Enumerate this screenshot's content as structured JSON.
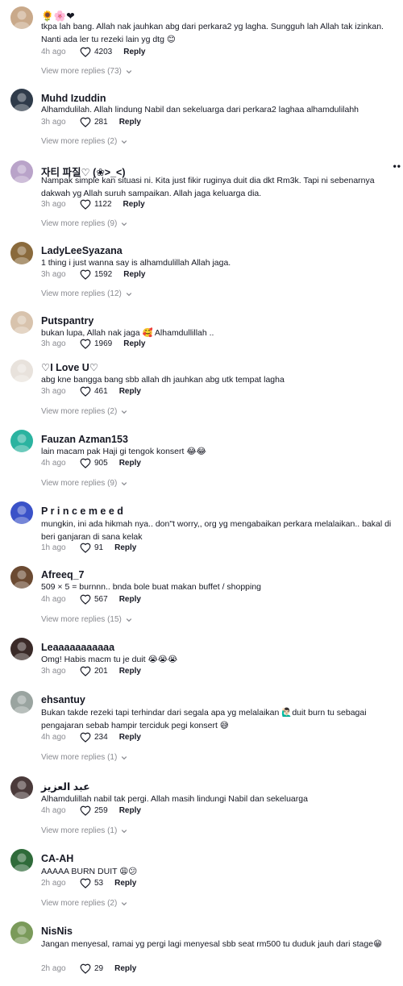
{
  "comments": [
    {
      "user": "🌻🌸❤",
      "text": "tkpa lah bang. Allah nak jauhkan abg dari perkara2 yg lagha. Sungguh lah Allah tak izinkan. Nanti ada ler tu rezeki lain yg dtg 😊",
      "time": "4h ago",
      "likes": "4203",
      "reply": "Reply",
      "more": "View more replies (73)",
      "avatar_color": "#c9a98a"
    },
    {
      "user": "Muhd Izuddin",
      "text": "Alhamdulilah. Allah lindung Nabil dan sekeluarga dari perkara2 laghaa alhamdulilahh",
      "time": "3h ago",
      "likes": "281",
      "reply": "Reply",
      "more": "View more replies (2)",
      "avatar_color": "#2f3b4a"
    },
    {
      "user": "자티 파질♡ (❀>_<)",
      "text": "Nampak simple kan situasi ni. Kita just fikir ruginya duit dia dkt Rm3k. Tapi ni sebenarnya dakwah yg Allah suruh sampaikan. Allah jaga keluarga dia.",
      "time": "3h ago",
      "likes": "1122",
      "reply": "Reply",
      "more": "View more replies (9)",
      "avatar_color": "#b9a3c9"
    },
    {
      "user": "LadyLeeSyazana",
      "text": "1 thing i just wanna say is alhamdulillah Allah jaga.",
      "time": "3h ago",
      "likes": "1592",
      "reply": "Reply",
      "more": "View more replies (12)",
      "avatar_color": "#8a6a3c"
    },
    {
      "user": "Putspantry",
      "text": "bukan lupa, Allah nak jaga 🥰 Alhamdullillah ..",
      "time": "3h ago",
      "likes": "1969",
      "reply": "Reply",
      "more": "",
      "avatar_color": "#d8c3ad"
    },
    {
      "user": "♡I Love U♡",
      "text": "abg kne bangga bang sbb allah dh jauhkan abg utk tempat lagha",
      "time": "3h ago",
      "likes": "461",
      "reply": "Reply",
      "more": "View more replies (2)",
      "avatar_color": "#e8e2dc"
    },
    {
      "user": "Fauzan Azman153",
      "text": "lain macam pak Haji gi tengok konsert 😂😂",
      "time": "4h ago",
      "likes": "905",
      "reply": "Reply",
      "more": "View more replies (9)",
      "avatar_color": "#2bb3a0"
    },
    {
      "user": "P r i n c e m e e d",
      "text": "mungkin, ini ada hikmah nya.. don\"t worry,, org yg mengabaikan perkara melalaikan.. bakal di beri ganjaran di sana kelak",
      "time": "1h ago",
      "likes": "91",
      "reply": "Reply",
      "more": "",
      "avatar_color": "#3a52c8"
    },
    {
      "user": "Afreeq_7",
      "text": "509 × 5 = burnnn.. bnda bole buat makan buffet / shopping",
      "time": "4h ago",
      "likes": "567",
      "reply": "Reply",
      "more": "View more replies (15)",
      "avatar_color": "#6b4a32"
    },
    {
      "user": "Leaaaaaaaaaaa",
      "text": "Omg! Habis macm tu je duit 😭😭😭",
      "time": "3h ago",
      "likes": "201",
      "reply": "Reply",
      "more": "",
      "avatar_color": "#3a2a28"
    },
    {
      "user": "ehsantuy",
      "text": "Bukan takde rezeki tapi terhindar dari segala apa yg melalaikan 🙋🏻‍♂️duit burn tu sebagai pengajaran sebab hampir terciduk pegi konsert 😅",
      "time": "4h ago",
      "likes": "234",
      "reply": "Reply",
      "more": "View more replies (1)",
      "avatar_color": "#9aa4a0"
    },
    {
      "user": "عبد العزيز",
      "text": "Alhamdulillah nabil tak pergi. Allah masih lindungi Nabil dan sekeluarga",
      "time": "4h ago",
      "likes": "259",
      "reply": "Reply",
      "more": "View more replies (1)",
      "avatar_color": "#4a3a3a"
    },
    {
      "user": "CA-AH",
      "text": "AAAAA BURN DUIT 😩😕",
      "time": "2h ago",
      "likes": "53",
      "reply": "Reply",
      "more": "View more replies (2)",
      "avatar_color": "#2f6b3a"
    },
    {
      "user": "NisNis",
      "text": "Jangan menyesal, ramai yg pergi lagi menyesal sbb seat rm500 tu duduk jauh dari stage😁",
      "time": "2h ago",
      "likes": "29",
      "reply": "Reply",
      "more": "",
      "avatar_color": "#7a9a5a"
    }
  ],
  "overflow_menu": "••"
}
